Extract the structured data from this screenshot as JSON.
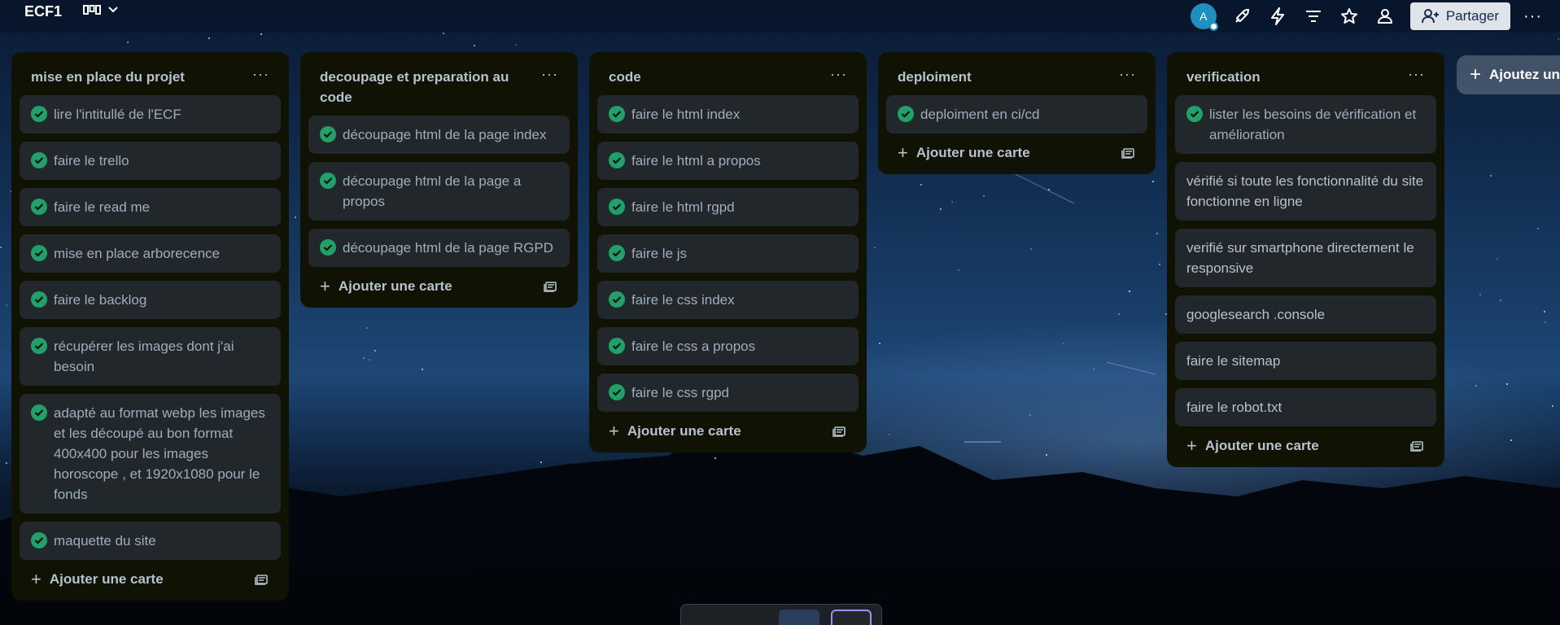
{
  "header": {
    "board_title": "ECF1",
    "avatar_initial": "A",
    "share_label": "Partager",
    "more_label": "···"
  },
  "lists": [
    {
      "title": "mise en place du projet",
      "menu": "···",
      "add_label": "Ajouter une carte",
      "cards": [
        {
          "text": "lire l'intitullé de l'ECF",
          "done": true
        },
        {
          "text": "faire le trello",
          "done": true
        },
        {
          "text": "faire le read me",
          "done": true
        },
        {
          "text": "mise en place arborecence",
          "done": true
        },
        {
          "text": "faire le backlog",
          "done": true
        },
        {
          "text": "récupérer les images dont j'ai besoin",
          "done": true
        },
        {
          "text": "adapté au format webp les images et les découpé au bon format 400x400 pour les images horoscope , et 1920x1080 pour le fonds",
          "done": true
        },
        {
          "text": "maquette du site",
          "done": true
        }
      ]
    },
    {
      "title": "decoupage et preparation au code",
      "menu": "···",
      "add_label": "Ajouter une carte",
      "cards": [
        {
          "text": "découpage html de la page index",
          "done": true
        },
        {
          "text": "découpage html de la page a propos",
          "done": true
        },
        {
          "text": "découpage html de la page RGPD",
          "done": true
        }
      ]
    },
    {
      "title": "code",
      "menu": "···",
      "add_label": "Ajouter une carte",
      "cards": [
        {
          "text": "faire le html index",
          "done": true
        },
        {
          "text": "faire le html a propos",
          "done": true
        },
        {
          "text": "faire le html rgpd",
          "done": true
        },
        {
          "text": "faire le js",
          "done": true
        },
        {
          "text": "faire le css index",
          "done": true
        },
        {
          "text": "faire le css a propos",
          "done": true
        },
        {
          "text": "faire le css rgpd",
          "done": true
        }
      ]
    },
    {
      "title": "deploiment",
      "menu": "···",
      "add_label": "Ajouter une carte",
      "cards": [
        {
          "text": "deploiment en ci/cd",
          "done": true
        }
      ]
    },
    {
      "title": "verification",
      "menu": "···",
      "add_label": "Ajouter une carte",
      "cards": [
        {
          "text": "lister les besoins de vérification et amélioration",
          "done": true
        },
        {
          "text": "vérifié si toute les fonctionnalité du site fonctionne en ligne",
          "done": false
        },
        {
          "text": "verifié sur smartphone directement le responsive",
          "done": false
        },
        {
          "text": "googlesearch .console",
          "done": false
        },
        {
          "text": "faire le sitemap",
          "done": false
        },
        {
          "text": "faire le robot.txt",
          "done": false
        }
      ]
    }
  ],
  "add_list_label": "Ajoutez une autre liste",
  "colors": {
    "list_bg": "#101204",
    "card_bg": "#22272b",
    "check_green": "#22a06b",
    "text": "#b6c2cf"
  }
}
